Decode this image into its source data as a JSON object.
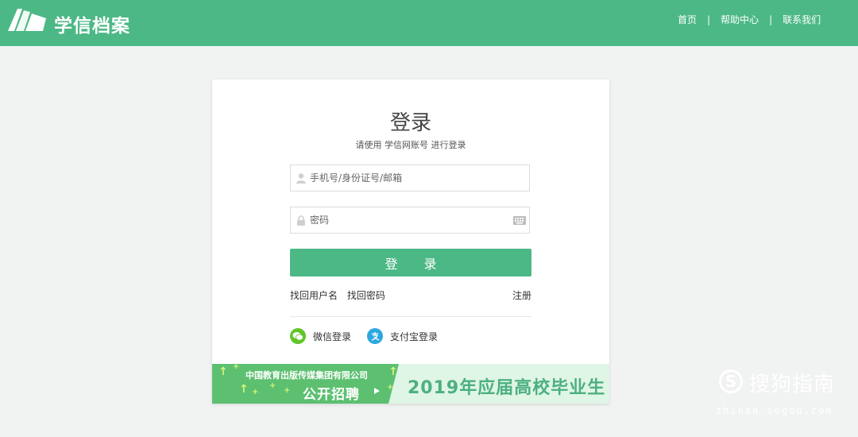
{
  "header": {
    "logo_text": "学信档案",
    "nav": [
      "首页",
      "帮助中心",
      "联系我们"
    ]
  },
  "login": {
    "title": "登录",
    "subtitle": "请使用 学信网账号 进行登录",
    "username_placeholder": "手机号/身份证号/邮箱",
    "password_placeholder": "密码",
    "submit_label": "登 录",
    "forgot_username": "找回用户名",
    "forgot_password": "找回密码",
    "register": "注册",
    "wechat_login": "微信登录",
    "alipay_login": "支付宝登录"
  },
  "banner": {
    "company": "中国教育出版传媒集团有限公司",
    "recruit": "公开招聘",
    "target": "2019年应届高校毕业生"
  },
  "watermark": {
    "name": "搜狗指南",
    "url": "zhinan.sogou.com"
  },
  "colors": {
    "brand": "#4cb886",
    "wechat": "#62c42a",
    "alipay": "#2ea7e0"
  }
}
